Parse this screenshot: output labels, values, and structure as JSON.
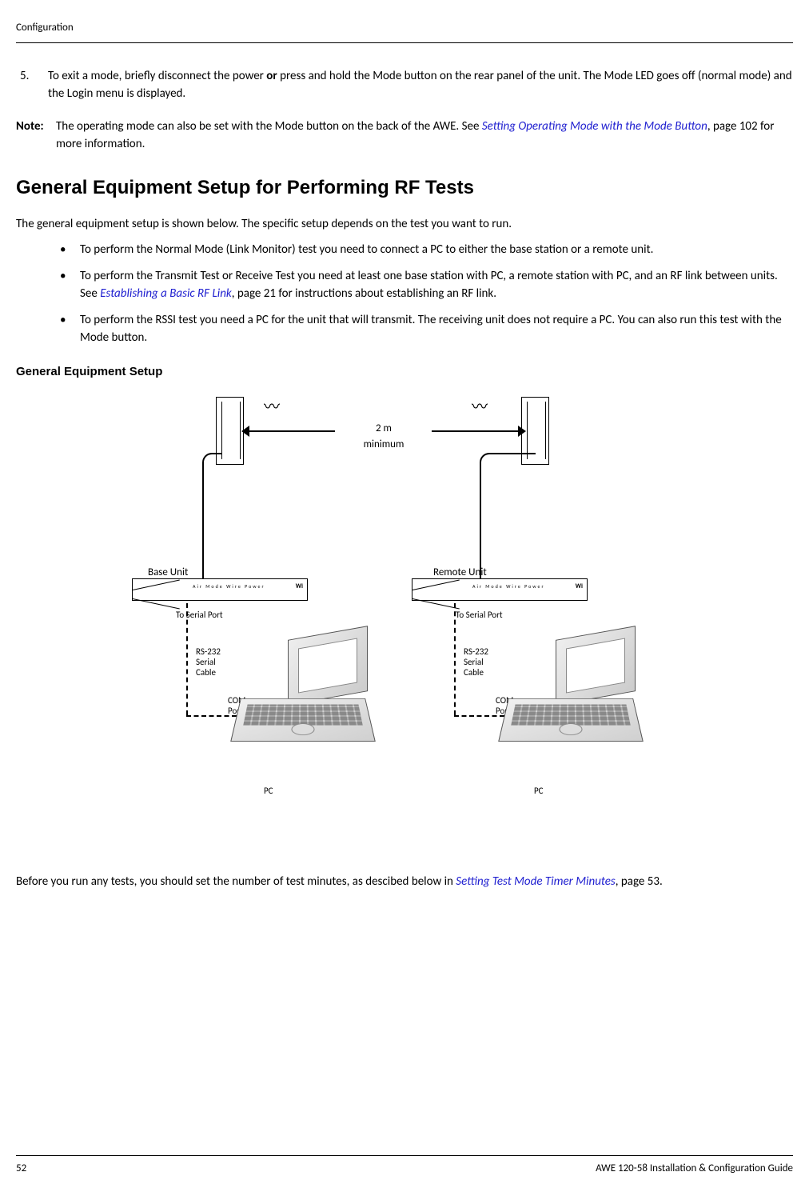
{
  "header": {
    "section": "Configuration"
  },
  "step": {
    "num": "5.",
    "text_a": "To exit a mode, briefly disconnect the power ",
    "text_b": "or",
    "text_c": " press and hold the Mode button on the rear panel of the unit. The Mode LED goes off (normal mode) and the Login menu is displayed."
  },
  "note": {
    "label": "Note:",
    "text_a": "The operating mode can also be set with the Mode button on the back of the AWE. See ",
    "link": "Setting Operating Mode with the Mode Button",
    "text_b": ", page 102 for more information."
  },
  "heading": "General Equipment Setup for Performing RF Tests",
  "intro": "The general equipment setup is shown below. The specific setup depends on the test you want to run.",
  "bullets": [
    {
      "text": "To perform the Normal Mode (Link Monitor) test you need to connect a PC to either the base station or a remote unit."
    },
    {
      "text_a": "To perform the Transmit Test or Receive Test you need at least one base station with PC, a remote station with PC, and an RF link between units. See ",
      "link": "Establishing a Basic RF Link",
      "text_b": ", page 21 for instructions about establishing an RF link."
    },
    {
      "text": "To perform the RSSI test you need a PC for the unit that will transmit. The receiving unit does not require a PC. You can also run this test with the Mode button."
    }
  ],
  "subheading": "General Equipment Setup",
  "diagram": {
    "distance_top": "2 m",
    "distance_bottom": "minimum",
    "base_unit": "Base Unit",
    "remote_unit": "Remote Unit",
    "serial_port": "To Serial Port",
    "rs232_l1": "RS-232",
    "rs232_l2": "Serial",
    "rs232_l3": "Cable",
    "com_l1": "COM",
    "com_l2": "Port",
    "pc": "PC",
    "device_labels": "Air   Mode  Wire            Power",
    "device_logo": "Wi"
  },
  "bottom": {
    "text_a": "Before you run any tests, you should set the number of test minutes, as descibed below in ",
    "link": "Setting Test Mode Timer Minutes",
    "text_b": ", page 53."
  },
  "footer": {
    "page": "52",
    "doc": "AWE 120-58 Installation & Configuration Guide"
  }
}
